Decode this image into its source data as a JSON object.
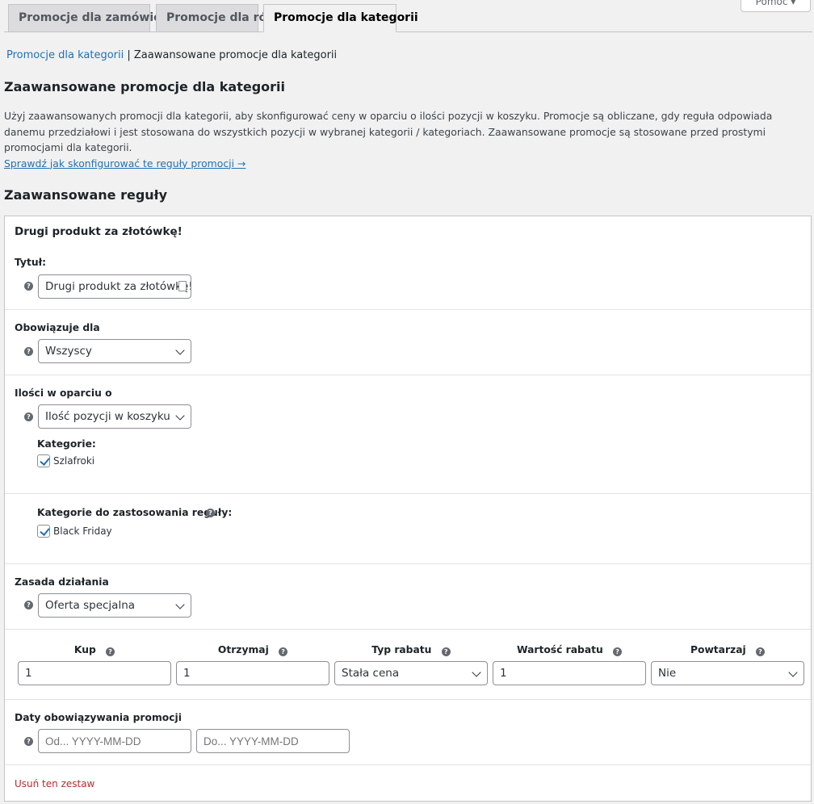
{
  "help_tab": "Pomoc",
  "tabs": [
    {
      "label": "Promocje dla zamówień"
    },
    {
      "label": "Promocje dla ról"
    },
    {
      "label": "Promocje dla kategorii"
    }
  ],
  "breadcrumb": {
    "link": "Promocje dla kategorii",
    "separator": "|",
    "current": "Zaawansowane promocje dla kategorii"
  },
  "page_title": "Zaawansowane promocje dla kategorii",
  "description": "Użyj zaawansowanych promocji dla kategorii, aby skonfigurować ceny w oparciu o ilości pozycji w koszyku. Promocje są obliczane, gdy reguła odpowiada danemu przedziałowi i jest stosowana do wszystkich pozycji w wybranej kategorii / kategoriach. Zaawansowane promocje są stosowane przed prostymi promocjami dla kategorii.",
  "description_link": "Sprawdź jak skonfigurować te reguły promocji →",
  "rules_title": "Zaawansowane reguły",
  "rule": {
    "name": "Drugi produkt za złotówkę!",
    "title_label": "Tytuł:",
    "title_value": "Drugi produkt za złotówkę!",
    "applies_label": "Obowiązuje dla",
    "applies_value": "Wszyscy",
    "qty_label": "Ilości w oparciu o",
    "qty_value": "Ilość pozycji w koszyku",
    "categories_label": "Kategorie:",
    "category_checked": "Szlafroki",
    "apply_categories_label": "Kategorie do zastosowania reguły:",
    "apply_category_checked": "Black Friday",
    "principle_label": "Zasada działania",
    "principle_value": "Oferta specjalna",
    "columns": {
      "buy": "Kup",
      "get": "Otrzymaj",
      "discount_type": "Typ rabatu",
      "discount_value": "Wartość rabatu",
      "repeat": "Powtarzaj"
    },
    "values": {
      "buy": "1",
      "get": "1",
      "discount_type": "Stała cena",
      "discount_value": "1",
      "repeat": "Nie"
    },
    "dates_label": "Daty obowiązywania promocji",
    "date_from_placeholder": "Od... YYYY-MM-DD",
    "date_to_placeholder": "Do... YYYY-MM-DD",
    "remove_link": "Usuń ten zestaw"
  }
}
